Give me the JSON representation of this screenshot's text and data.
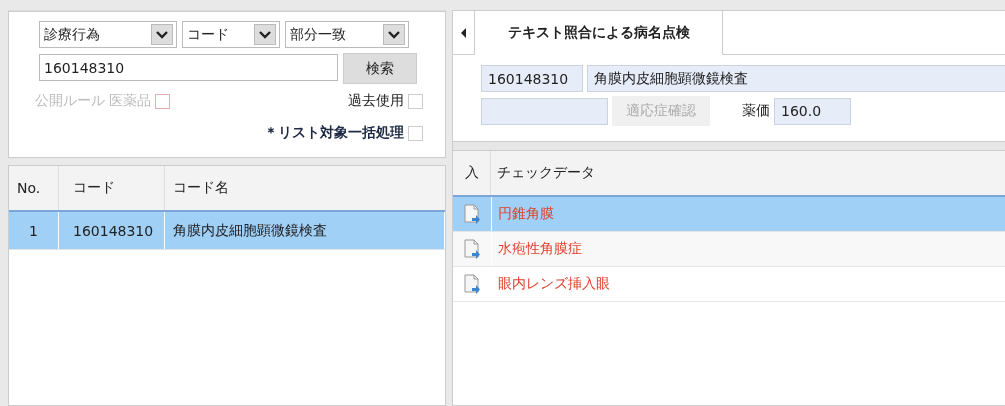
{
  "search": {
    "selects": [
      {
        "value": "診療行為"
      },
      {
        "value": "コード"
      },
      {
        "value": "部分一致"
      }
    ],
    "query": "160148310",
    "search_button": "検索",
    "options": [
      {
        "label": "公開ルール 医薬品",
        "checked": false,
        "disabled": true
      },
      {
        "label": "過去使用",
        "checked": false,
        "disabled": false
      },
      {
        "label": "＊リスト対象一括処理",
        "checked": false,
        "disabled": false
      }
    ]
  },
  "code_table": {
    "columns": [
      "No.",
      "コード",
      "コード名"
    ],
    "rows": [
      {
        "no": "1",
        "code": "160148310",
        "name": "角膜内皮細胞顕微鏡検査",
        "selected": true
      }
    ]
  },
  "detail": {
    "tab": "テキスト照合による病名点検",
    "code": "160148310",
    "name": "角膜内皮細胞顕微鏡検査",
    "confirm_button": "適応症確認",
    "price_label": "薬価",
    "price": "160.0"
  },
  "check_table": {
    "columns": [
      "入",
      "チェックデータ"
    ],
    "rows": [
      {
        "text": "円錐角膜",
        "selected": true
      },
      {
        "text": "水疱性角膜症",
        "selected": false
      },
      {
        "text": "眼内レンズ挿入眼",
        "selected": false
      }
    ]
  }
}
